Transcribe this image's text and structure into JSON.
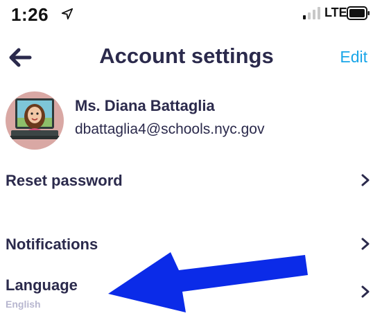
{
  "status_bar": {
    "time": "1:26",
    "network": "LTE",
    "icons": [
      "location-arrow-icon",
      "signal-icon",
      "battery-icon"
    ]
  },
  "header": {
    "title": "Account settings",
    "edit_label": "Edit",
    "back_icon": "back-arrow-icon"
  },
  "profile": {
    "name": "Ms. Diana Battaglia",
    "email": "dbattaglia4@schools.nyc.gov"
  },
  "rows": [
    {
      "label": "Reset password",
      "sub": ""
    },
    {
      "label": "Notifications",
      "sub": ""
    },
    {
      "label": "Language",
      "sub": "English"
    }
  ],
  "colors": {
    "primary_text": "#2b2a4c",
    "accent": "#1aa6e8",
    "muted": "#b7b6cf",
    "annotation_arrow": "#0b2be8"
  }
}
